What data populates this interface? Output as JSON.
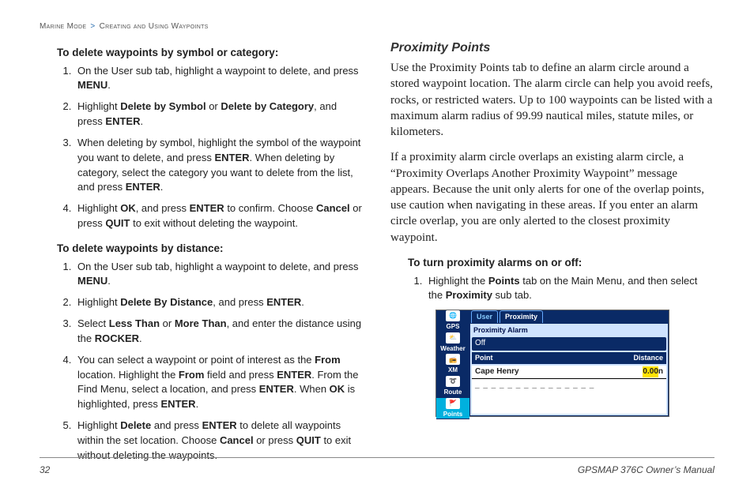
{
  "breadcrumb": {
    "a": "Marine Mode",
    "sep": ">",
    "b": "Creating and Using Waypoints"
  },
  "left": {
    "h1": "To delete waypoints by symbol or category:",
    "s1": [
      "On the User sub tab, highlight a waypoint to delete, and press <b>MENU</b>.",
      "Highlight <b>Delete by Symbol</b> or <b>Delete by Category</b>, and press <b>ENTER</b>.",
      "When deleting by symbol, highlight the symbol of the waypoint you want to delete, and press <b>ENTER</b>. When deleting by category, select the category you want to delete from the list, and press <b>ENTER</b>.",
      "Highlight <b>OK</b>, and press <b>ENTER</b> to confirm. Choose <b>Cancel</b> or press <b>QUIT</b> to exit without deleting the waypoint."
    ],
    "h2": "To delete waypoints by distance:",
    "s2": [
      "On the User sub tab, highlight a waypoint to delete, and press <b>MENU</b>.",
      "Highlight <b>Delete By Distance</b>, and press <b>ENTER</b>.",
      "Select <b>Less Than</b> or <b>More Than</b>, and enter the distance using the <b>ROCKER</b>.",
      "You can select a waypoint or point of interest as the <b>From</b> location. Highlight the <b>From</b> field and press <b>ENTER</b>. From the Find Menu, select a location, and press <b>ENTER</b>. When <b>OK</b> is highlighted, press <b>ENTER</b>.",
      "Highlight <b>Delete</b> and press <b>ENTER</b> to delete all waypoints within the set location. Choose <b>Cancel</b> or press <b>QUIT</b> to exit without deleting the waypoints."
    ]
  },
  "right": {
    "title": "Proximity Points",
    "p1": "Use the Proximity Points tab to define an alarm circle around a stored waypoint location. The alarm circle can help you avoid reefs, rocks, or restricted waters. Up to 100 waypoints can be listed with a maximum alarm radius of 99.99 nautical miles, statute miles, or kilometers.",
    "p2": "If a proximity alarm circle overlaps an existing alarm circle, a “Proximity Overlaps Another Proximity Waypoint” message appears. Because the unit only alerts for one of the overlap points, use caution when navigating in these areas. If you enter an alarm circle overlap, you are only alerted to the closest proximity waypoint.",
    "h3": "To turn proximity alarms on or off:",
    "s3": [
      "Highlight the <b>Points</b> tab on the Main Menu, and then select the <b>Proximity</b> sub tab."
    ]
  },
  "device": {
    "side": [
      "GPS",
      "Weather",
      "XM",
      "Route",
      "Points"
    ],
    "tabs": {
      "a": "User",
      "b": "Proximity"
    },
    "alarmLabel": "Proximity Alarm",
    "alarmValue": "Off",
    "col1": "Point",
    "col2": "Distance",
    "rowName": "Cape Henry",
    "rowDist": "0.00",
    "unit": "n",
    "dashes": "_ _ _ _ _ _ _ _ _ _ _ _ _ _ _"
  },
  "footer": {
    "page": "32",
    "manual": "GPSMAP 376C Owner’s Manual"
  }
}
